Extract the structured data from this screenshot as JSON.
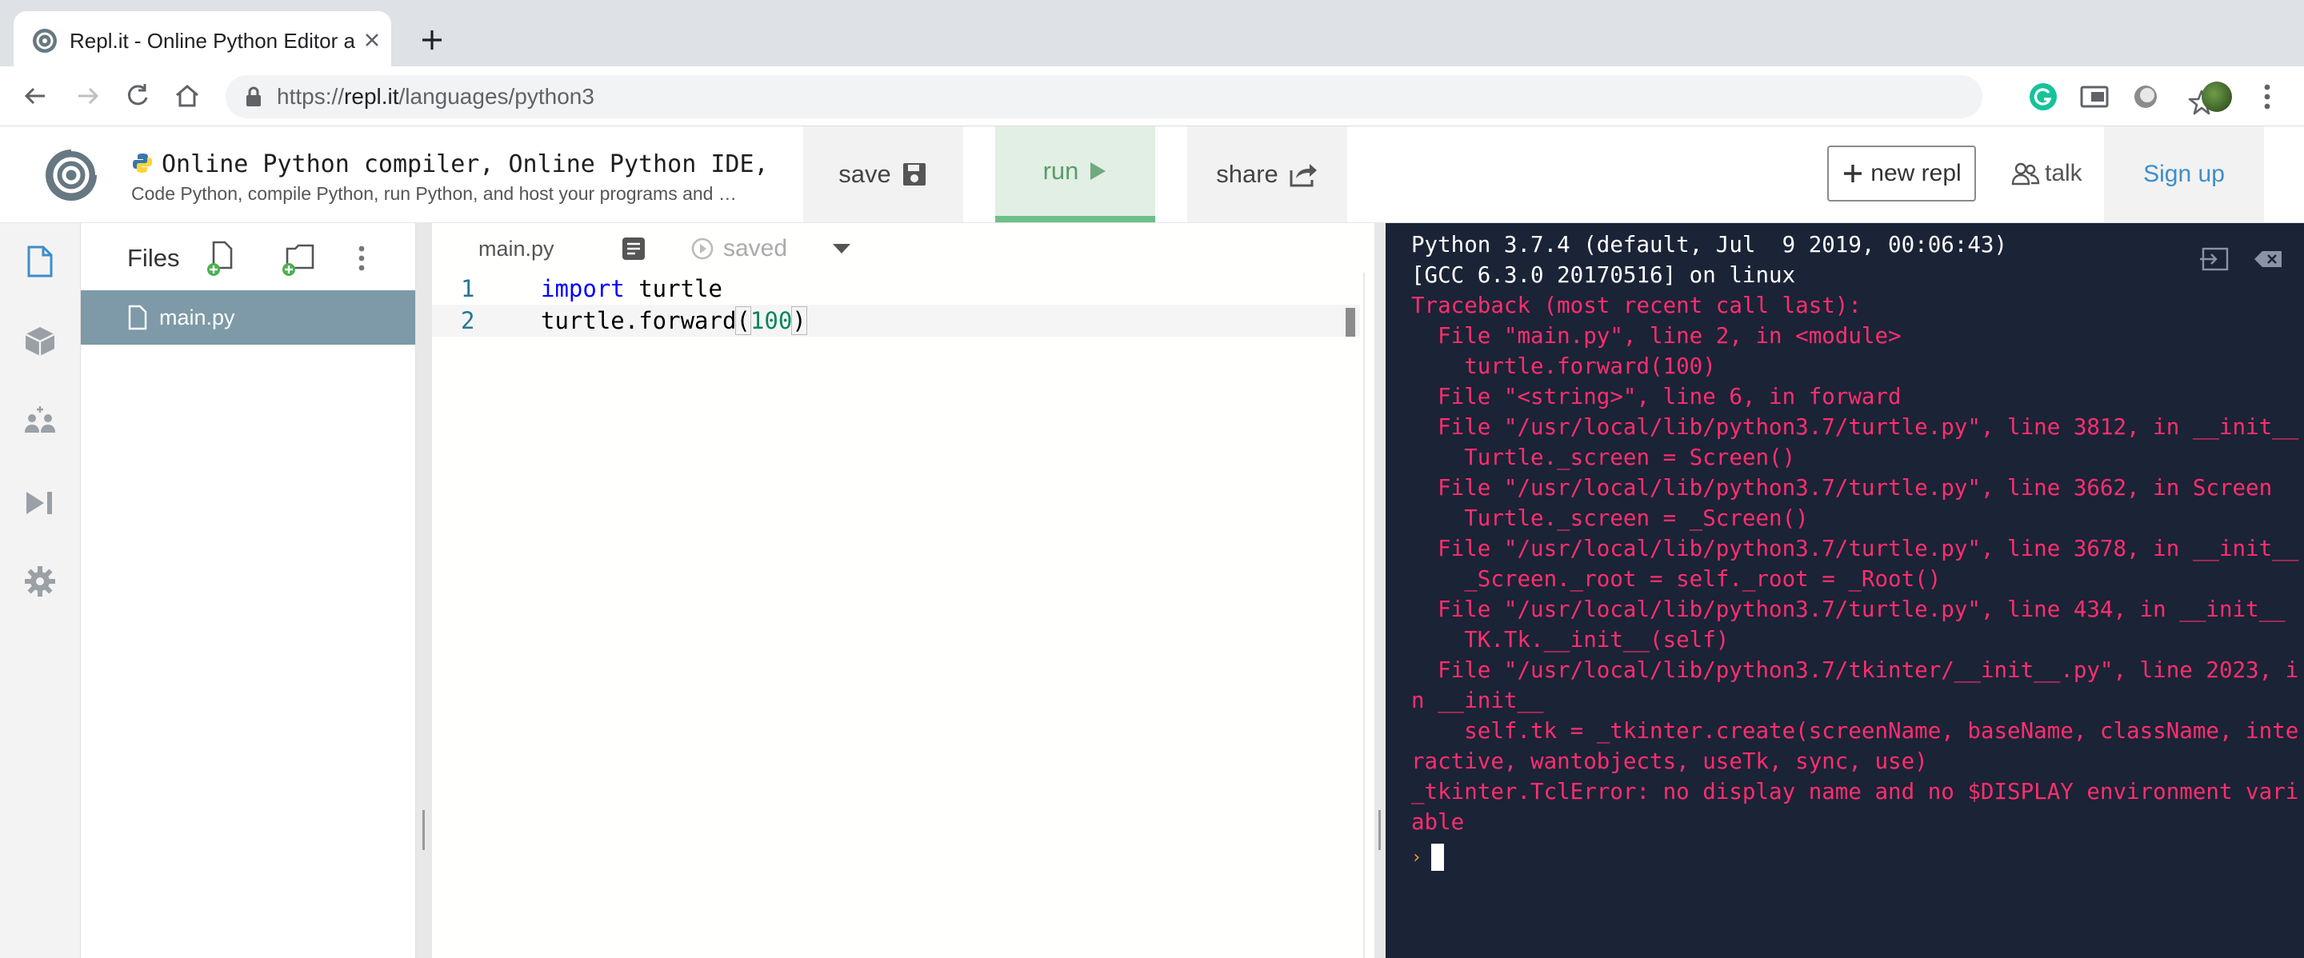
{
  "browser": {
    "tab_title": "Repl.it - Online Python Editor a",
    "url_scheme": "https://",
    "url_host": "repl.it",
    "url_path": "/languages/python3",
    "icons": [
      "back-arrow-icon",
      "forward-arrow-icon",
      "reload-icon",
      "home-icon",
      "lock-icon",
      "star-icon",
      "grammarly-icon",
      "cast-icon",
      "extension-icon",
      "profile-avatar",
      "menu-kebab-icon"
    ]
  },
  "header": {
    "title": "Online Python compiler, Online Python IDE, …",
    "description": "Code Python, compile Python, run Python, and host your programs and …",
    "save_label": "save",
    "run_label": "run",
    "share_label": "share",
    "new_repl_label": "new repl",
    "talk_label": "talk",
    "signup_label": "Sign up"
  },
  "files": {
    "title": "Files",
    "items": [
      {
        "name": "main.py",
        "selected": true
      }
    ]
  },
  "editor": {
    "tab_label": "main.py",
    "status": "saved",
    "lines": [
      {
        "n": "1"
      },
      {
        "n": "2"
      }
    ]
  },
  "console": {
    "lines": [
      {
        "text": "Python 3.7.4 (default, Jul  9 2019, 00:06:43)",
        "type": "info"
      },
      {
        "text": "[GCC 6.3.0 20170516] on linux",
        "type": "info"
      },
      {
        "text": "Traceback (most recent call last):",
        "type": "err"
      },
      {
        "text": "  File \"main.py\", line 2, in <module>",
        "type": "err"
      },
      {
        "text": "    turtle.forward(100)",
        "type": "err"
      },
      {
        "text": "  File \"<string>\", line 6, in forward",
        "type": "err"
      },
      {
        "text": "  File \"/usr/local/lib/python3.7/turtle.py\", line 3812, in __init__",
        "type": "err"
      },
      {
        "text": "    Turtle._screen = Screen()",
        "type": "err"
      },
      {
        "text": "  File \"/usr/local/lib/python3.7/turtle.py\", line 3662, in Screen",
        "type": "err"
      },
      {
        "text": "    Turtle._screen = _Screen()",
        "type": "err"
      },
      {
        "text": "  File \"/usr/local/lib/python3.7/turtle.py\", line 3678, in __init__",
        "type": "err"
      },
      {
        "text": "    _Screen._root = self._root = _Root()",
        "type": "err"
      },
      {
        "text": "  File \"/usr/local/lib/python3.7/turtle.py\", line 434, in __init__",
        "type": "err"
      },
      {
        "text": "    TK.Tk.__init__(self)",
        "type": "err"
      },
      {
        "text": "  File \"/usr/local/lib/python3.7/tkinter/__init__.py\", line 2023, i",
        "type": "err"
      },
      {
        "text": "n __init__",
        "type": "err"
      },
      {
        "text": "    self.tk = _tkinter.create(screenName, baseName, className, inte",
        "type": "err"
      },
      {
        "text": "ractive, wantobjects, useTk, sync, use)",
        "type": "err"
      },
      {
        "text": "_tkinter.TclError: no display name and no $DISPLAY environment vari",
        "type": "err"
      },
      {
        "text": "able",
        "type": "err"
      }
    ],
    "prompt_symbol": "›"
  },
  "colors": {
    "run_accent": "#6fbf8a",
    "console_bg": "#1b2336",
    "console_error": "#ff2e6e",
    "file_selected": "#7e9aa8",
    "signup": "#3d8ec9"
  }
}
